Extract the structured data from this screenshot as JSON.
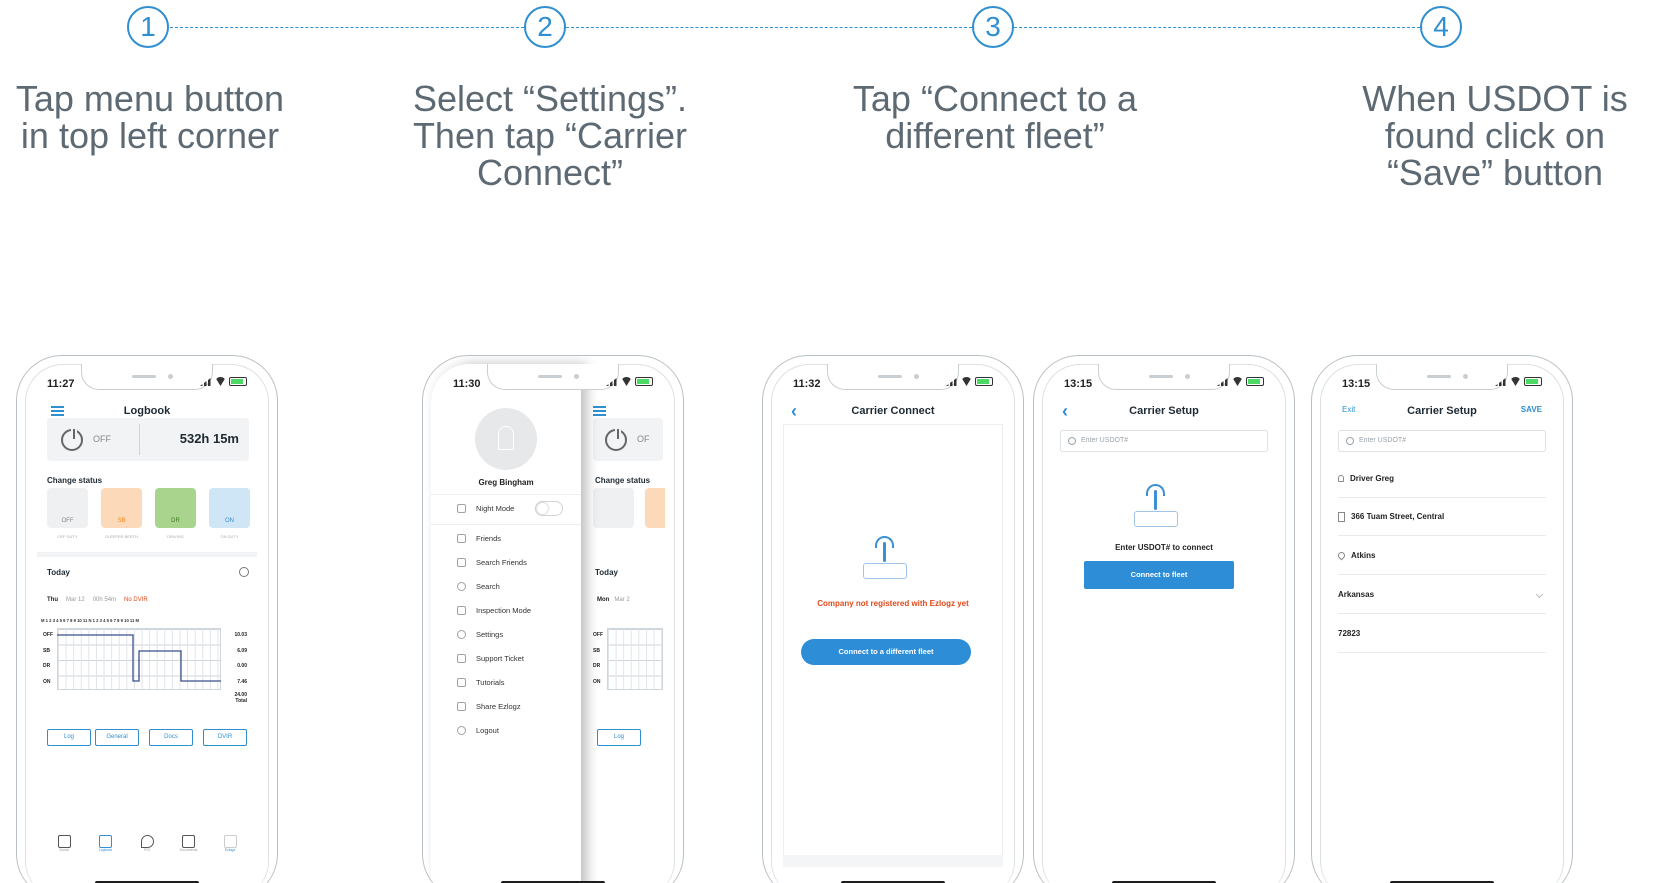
{
  "steps": [
    {
      "number": "1",
      "text": "Tap menu button in top left corner"
    },
    {
      "number": "2",
      "text": "Select “Settings”. Then tap “Carrier Connect”"
    },
    {
      "number": "3",
      "text": "Tap “Connect to a different fleet”"
    },
    {
      "number": "4",
      "text": "When USDOT is found click on “Save” button"
    }
  ],
  "phone1": {
    "time": "11:27",
    "title": "Logbook",
    "status_label": "OFF",
    "hours": "532h 15m",
    "change_status": "Change status",
    "statuses": [
      {
        "code": "OFF",
        "caption": "OFF DUTY",
        "color": "#eef0f1",
        "fg": "#888888"
      },
      {
        "code": "SB",
        "caption": "SLEEPER BERTH",
        "color": "#fcd9b8",
        "fg": "#f08a24"
      },
      {
        "code": "DR",
        "caption": "DRIVING",
        "color": "#a9d48d",
        "fg": "#5a9c34"
      },
      {
        "code": "ON",
        "caption": "ON DUTY",
        "color": "#cfe6f7",
        "fg": "#2f8fd1"
      }
    ],
    "today": "Today",
    "day": "Thu",
    "date": "Mar 12",
    "duration": "00h 54m",
    "dvir": "No DVIR",
    "hours_scale": "M 1 2 3 4 5 6 7 8 9 10 11 N 1 2 3 4 5 6 7 8 9 10 11 M",
    "rows": [
      {
        "label": "OFF",
        "value": "10.03"
      },
      {
        "label": "SB",
        "value": "6.09"
      },
      {
        "label": "DR",
        "value": "0.00"
      },
      {
        "label": "ON",
        "value": "7.46"
      }
    ],
    "total_value": "24.00",
    "total_label": "Total",
    "buttons": [
      "Log",
      "General",
      "Docs",
      "DVIR"
    ],
    "tabs": [
      "Social",
      "Logbook",
      "POI",
      "Documents",
      "Ezlogz"
    ]
  },
  "phone2": {
    "time": "11:30",
    "user": "Greg Bingham",
    "night_mode": "Night Mode",
    "menu": [
      "Friends",
      "Search Friends",
      "Search",
      "Inspection Mode",
      "Settings",
      "Support Ticket",
      "Tutorials",
      "Share Ezlogz",
      "Logout"
    ],
    "bg_status": "OF",
    "bg_change_status": "Change status",
    "bg_today": "Today",
    "bg_day": "Mon",
    "bg_date": "Mar 2",
    "bg_rows": [
      "OFF",
      "SB",
      "DR",
      "ON"
    ],
    "bg_button": "Log"
  },
  "phone3": {
    "time": "11:32",
    "title": "Carrier Connect",
    "message": "Company not registered with Ezlogz yet",
    "button": "Connect to a different fleet"
  },
  "phone4": {
    "time": "13:15",
    "title": "Carrier Setup",
    "placeholder": "Enter USDOT#",
    "prompt": "Enter USDOT# to connect",
    "button": "Connect to fleet"
  },
  "phone5": {
    "time": "13:15",
    "exit": "Exit",
    "title": "Carrier Setup",
    "save": "SAVE",
    "placeholder": "Enter USDOT#",
    "driver": "Driver Greg",
    "street": "366 Tuam Street, Central",
    "city": "Atkins",
    "state": "Arkansas",
    "zip": "72823"
  },
  "colors": {
    "accent": "#2f8fd1",
    "button": "#2d8dd6",
    "error": "#e04a1b"
  }
}
